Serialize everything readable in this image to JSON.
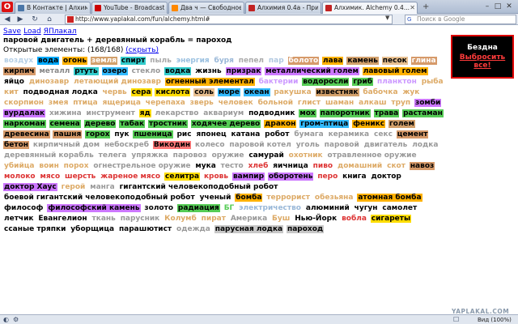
{
  "browser": {
    "menu_glyph": "O",
    "tabs": [
      {
        "label": "В Контакте | Алхими...",
        "favicon_color": "#4a76a8"
      },
      {
        "label": "YouTube - Broadcast Y...",
        "favicon_color": "#cc0000"
      },
      {
        "label": "Два ч — Свободное о...",
        "favicon_color": "#ff8800"
      },
      {
        "label": "Алхимия 0.4а - Прико...",
        "favicon_color": "#c22222"
      },
      {
        "label": "Алхимик. Alchemy 0.4...",
        "favicon_color": "#c22222",
        "active": true
      }
    ],
    "new_tab": "+",
    "address": "http://www.yaplakal.com/fun/alchemy.html#",
    "search_placeholder": "Поиск в Google",
    "search_engine_glyph": "G",
    "zoom_label": "Вид (100%)",
    "nav": {
      "back": "◀",
      "forward": "▶",
      "reload": "↻",
      "home": "⌂"
    },
    "window": {
      "minimize": "–",
      "maximize": "□",
      "close": "✕"
    },
    "status_icons": [
      "◐",
      "⚙",
      "☐"
    ]
  },
  "page": {
    "links": [
      "Save",
      "Load",
      "ЯПлакал"
    ],
    "recipe": "паровой двигатель + деревянный корабль = пароход",
    "opened_prefix": "Открытые элементы: (168/168)",
    "hide_link": "(скрыть)",
    "abyss_title": "Бездна",
    "abyss_link": "Выбросить все!",
    "watermark": "YAPLAKAL.COM",
    "elements": [
      {
        "t": "воздух",
        "bg": "#ffffff",
        "fg": "#b5cfe6"
      },
      {
        "t": "вода",
        "bg": "#00aaff",
        "fg": "#000000"
      },
      {
        "t": "огонь",
        "bg": "#ffb100",
        "fg": "#000000"
      },
      {
        "t": "земля",
        "bg": "#d2a06b",
        "fg": "#ffffff"
      },
      {
        "t": "спирт",
        "bg": "#33cccc",
        "fg": "#000000"
      },
      {
        "t": "пыль",
        "bg": "#ffffff",
        "fg": "#aaaaaa"
      },
      {
        "t": "энергия",
        "bg": "#ffffff",
        "fg": "#9ac0e0"
      },
      {
        "t": "буря",
        "bg": "#ffffff",
        "fg": "#9ab8d8"
      },
      {
        "t": "пепел",
        "bg": "#ffffff",
        "fg": "#aaaaaa"
      },
      {
        "t": "пар",
        "bg": "#ffffff",
        "fg": "#b0c8e0"
      },
      {
        "t": "болото",
        "bg": "#d69a6a",
        "fg": "#ffffff"
      },
      {
        "t": "лава",
        "bg": "#ffb100",
        "fg": "#000000"
      },
      {
        "t": "камень",
        "bg": "#d2a06b",
        "fg": "#000000"
      },
      {
        "t": "песок",
        "bg": "#e8c090",
        "fg": "#000000"
      },
      {
        "t": "глина",
        "bg": "#d69a6a",
        "fg": "#ffffff"
      },
      {
        "t": "кирпич",
        "bg": "#d69a6a",
        "fg": "#000000"
      },
      {
        "t": "металл",
        "bg": "#ffffff",
        "fg": "#888888"
      },
      {
        "t": "ртуть",
        "bg": "#33cccc",
        "fg": "#000000"
      },
      {
        "t": "озеро",
        "bg": "#33bbff",
        "fg": "#000000"
      },
      {
        "t": "стекло",
        "bg": "#ffffff",
        "fg": "#999999"
      },
      {
        "t": "водка",
        "bg": "#33cccc",
        "fg": "#000000"
      },
      {
        "t": "жизнь",
        "bg": "#ffffff",
        "fg": "#000000"
      },
      {
        "t": "призрак",
        "bg": "#cc77ff",
        "fg": "#000000"
      },
      {
        "t": "металлический голем",
        "bg": "#cc77ff",
        "fg": "#000000"
      },
      {
        "t": "лавовый голем",
        "bg": "#ffb100",
        "fg": "#000000"
      },
      {
        "t": "яйцо",
        "bg": "#ffffff",
        "fg": "#000000"
      },
      {
        "t": "динозавр",
        "bg": "#ffffff",
        "fg": "#ddaa66"
      },
      {
        "t": "летающий динозавр",
        "bg": "#ffffff",
        "fg": "#ddaa66"
      },
      {
        "t": "огненный элементал",
        "bg": "#ffb100",
        "fg": "#000000"
      },
      {
        "t": "бактерии",
        "bg": "#ffffff",
        "fg": "#cc99ff"
      },
      {
        "t": "водоросли",
        "bg": "#55cc55",
        "fg": "#000000"
      },
      {
        "t": "гриб",
        "bg": "#55cc55",
        "fg": "#000000"
      },
      {
        "t": "планктон",
        "bg": "#ffffff",
        "fg": "#cc99ff"
      },
      {
        "t": "рыба",
        "bg": "#ffffff",
        "fg": "#ddaa66"
      },
      {
        "t": "кит",
        "bg": "#ffffff",
        "fg": "#ddaa66"
      },
      {
        "t": "подводная лодка",
        "bg": "#ffffff",
        "fg": "#000000"
      },
      {
        "t": "червь",
        "bg": "#ffffff",
        "fg": "#ddaa66"
      },
      {
        "t": "сера",
        "bg": "#ffdd00",
        "fg": "#000000"
      },
      {
        "t": "кислота",
        "bg": "#ffdd00",
        "fg": "#000000"
      },
      {
        "t": "соль",
        "bg": "#e8c090",
        "fg": "#000000"
      },
      {
        "t": "море",
        "bg": "#33bbff",
        "fg": "#000000"
      },
      {
        "t": "океан",
        "bg": "#33bbff",
        "fg": "#000000"
      },
      {
        "t": "ракушка",
        "bg": "#ffffff",
        "fg": "#ddaa66"
      },
      {
        "t": "известняк",
        "bg": "#d2a06b",
        "fg": "#000000"
      },
      {
        "t": "бабочка",
        "bg": "#ffffff",
        "fg": "#ddaa66"
      },
      {
        "t": "жук",
        "bg": "#ffffff",
        "fg": "#ddaa66"
      },
      {
        "t": "скорпион",
        "bg": "#ffffff",
        "fg": "#ddaa66"
      },
      {
        "t": "змея",
        "bg": "#ffffff",
        "fg": "#ddaa66"
      },
      {
        "t": "птица",
        "bg": "#ffffff",
        "fg": "#ddaa66"
      },
      {
        "t": "ящерица",
        "bg": "#ffffff",
        "fg": "#ddaa66"
      },
      {
        "t": "черепаха",
        "bg": "#ffffff",
        "fg": "#ddaa66"
      },
      {
        "t": "зверь",
        "bg": "#ffffff",
        "fg": "#ddaa66"
      },
      {
        "t": "человек",
        "bg": "#ffffff",
        "fg": "#ddaa66"
      },
      {
        "t": "больной",
        "bg": "#ffffff",
        "fg": "#ddaa66"
      },
      {
        "t": "глист",
        "bg": "#ffffff",
        "fg": "#ddaa66"
      },
      {
        "t": "шаман",
        "bg": "#ffffff",
        "fg": "#ddaa66"
      },
      {
        "t": "алкаш",
        "bg": "#ffffff",
        "fg": "#ddaa66"
      },
      {
        "t": "труп",
        "bg": "#ffffff",
        "fg": "#ddaa66"
      },
      {
        "t": "зомби",
        "bg": "#cc77ff",
        "fg": "#000000"
      },
      {
        "t": "вурдалак",
        "bg": "#cc77ff",
        "fg": "#000000"
      },
      {
        "t": "хижина",
        "bg": "#ffffff",
        "fg": "#999999"
      },
      {
        "t": "инструмент",
        "bg": "#ffffff",
        "fg": "#999999"
      },
      {
        "t": "яд",
        "bg": "#ffdd00",
        "fg": "#000000"
      },
      {
        "t": "лекарство",
        "bg": "#ffffff",
        "fg": "#999999"
      },
      {
        "t": "аквариум",
        "bg": "#ffffff",
        "fg": "#999999"
      },
      {
        "t": "подводник",
        "bg": "#ffffff",
        "fg": "#000000"
      },
      {
        "t": "мох",
        "bg": "#55cc55",
        "fg": "#000000"
      },
      {
        "t": "папоротник",
        "bg": "#55cc55",
        "fg": "#000000"
      },
      {
        "t": "трава",
        "bg": "#55cc55",
        "fg": "#000000"
      },
      {
        "t": "растаман",
        "bg": "#55cc55",
        "fg": "#000000"
      },
      {
        "t": "наркоман",
        "bg": "#55cc55",
        "fg": "#000000"
      },
      {
        "t": "семена",
        "bg": "#55cc55",
        "fg": "#000000"
      },
      {
        "t": "дерево",
        "bg": "#55cc55",
        "fg": "#000000"
      },
      {
        "t": "табак",
        "bg": "#55cc55",
        "fg": "#000000"
      },
      {
        "t": "тростник",
        "bg": "#55cc55",
        "fg": "#000000"
      },
      {
        "t": "ходячее дерево",
        "bg": "#55cc55",
        "fg": "#000000"
      },
      {
        "t": "дракон",
        "bg": "#ffb100",
        "fg": "#000000"
      },
      {
        "t": "гром-птица",
        "bg": "#33bbff",
        "fg": "#000000"
      },
      {
        "t": "феникс",
        "bg": "#ffb100",
        "fg": "#000000"
      },
      {
        "t": "голем",
        "bg": "#d2a06b",
        "fg": "#000000"
      },
      {
        "t": "древесина",
        "bg": "#d69a6a",
        "fg": "#000000"
      },
      {
        "t": "пашня",
        "bg": "#d69a6a",
        "fg": "#000000"
      },
      {
        "t": "горох",
        "bg": "#55cc55",
        "fg": "#000000"
      },
      {
        "t": "пук",
        "bg": "#ffffff",
        "fg": "#000000"
      },
      {
        "t": "пшеница",
        "bg": "#55cc55",
        "fg": "#000000"
      },
      {
        "t": "рис",
        "bg": "#ffffff",
        "fg": "#000000"
      },
      {
        "t": "японец",
        "bg": "#ffffff",
        "fg": "#000000"
      },
      {
        "t": "катана",
        "bg": "#ffffff",
        "fg": "#000000"
      },
      {
        "t": "робот",
        "bg": "#ffffff",
        "fg": "#000000"
      },
      {
        "t": "бумага",
        "bg": "#ffffff",
        "fg": "#999999"
      },
      {
        "t": "керамика",
        "bg": "#ffffff",
        "fg": "#999999"
      },
      {
        "t": "секс",
        "bg": "#ffffff",
        "fg": "#999999"
      },
      {
        "t": "цемент",
        "bg": "#d69a6a",
        "fg": "#000000"
      },
      {
        "t": "бетон",
        "bg": "#d69a6a",
        "fg": "#000000"
      },
      {
        "t": "кирпичный дом",
        "bg": "#ffffff",
        "fg": "#999999"
      },
      {
        "t": "небоскреб",
        "bg": "#ffffff",
        "fg": "#999999"
      },
      {
        "t": "Викодин",
        "bg": "#ff7777",
        "fg": "#000000"
      },
      {
        "t": "колесо",
        "bg": "#ffffff",
        "fg": "#999999"
      },
      {
        "t": "паровой котел",
        "bg": "#ffffff",
        "fg": "#999999"
      },
      {
        "t": "уголь",
        "bg": "#ffffff",
        "fg": "#999999"
      },
      {
        "t": "паровой",
        "bg": "#ffffff",
        "fg": "#999999"
      },
      {
        "t": "двигатель",
        "bg": "#ffffff",
        "fg": "#999999"
      },
      {
        "t": "лодка",
        "bg": "#ffffff",
        "fg": "#999999"
      },
      {
        "t": "деревянный корабль",
        "bg": "#ffffff",
        "fg": "#999999"
      },
      {
        "t": "телега",
        "bg": "#ffffff",
        "fg": "#999999"
      },
      {
        "t": "упряжка",
        "bg": "#ffffff",
        "fg": "#999999"
      },
      {
        "t": "паровоз",
        "bg": "#ffffff",
        "fg": "#999999"
      },
      {
        "t": "оружие",
        "bg": "#ffffff",
        "fg": "#999999"
      },
      {
        "t": "самурай",
        "bg": "#ffffff",
        "fg": "#000000"
      },
      {
        "t": "охотник",
        "bg": "#ffffff",
        "fg": "#ddaa66"
      },
      {
        "t": "отравленное оружие",
        "bg": "#ffffff",
        "fg": "#999999"
      },
      {
        "t": "убийца",
        "bg": "#ffffff",
        "fg": "#ddaa66"
      },
      {
        "t": "воин",
        "bg": "#ffffff",
        "fg": "#ddaa66"
      },
      {
        "t": "порох",
        "bg": "#ffffff",
        "fg": "#ddaa66"
      },
      {
        "t": "огнестрельное оружие",
        "bg": "#ffffff",
        "fg": "#999999"
      },
      {
        "t": "мука",
        "bg": "#ffffff",
        "fg": "#000000"
      },
      {
        "t": "тесто",
        "bg": "#ffffff",
        "fg": "#999999"
      },
      {
        "t": "хлеб",
        "bg": "#ffffff",
        "fg": "#dd3333"
      },
      {
        "t": "яичница",
        "bg": "#ffffff",
        "fg": "#000000"
      },
      {
        "t": "пиво",
        "bg": "#ffffff",
        "fg": "#dd3333"
      },
      {
        "t": "домашний",
        "bg": "#ffffff",
        "fg": "#ddaa66"
      },
      {
        "t": "скот",
        "bg": "#ffffff",
        "fg": "#ddaa66"
      },
      {
        "t": "навоз",
        "bg": "#d69a6a",
        "fg": "#000000"
      },
      {
        "t": "молоко",
        "bg": "#ffffff",
        "fg": "#dd3333"
      },
      {
        "t": "мясо",
        "bg": "#ffffff",
        "fg": "#dd3333"
      },
      {
        "t": "шерсть",
        "bg": "#ffffff",
        "fg": "#dd3333"
      },
      {
        "t": "жареное мясо",
        "bg": "#ffffff",
        "fg": "#dd3333"
      },
      {
        "t": "селитра",
        "bg": "#ffdd00",
        "fg": "#000000"
      },
      {
        "t": "кровь",
        "bg": "#ffffff",
        "fg": "#dd3333"
      },
      {
        "t": "вампир",
        "bg": "#cc77ff",
        "fg": "#000000"
      },
      {
        "t": "оборотень",
        "bg": "#cc77ff",
        "fg": "#000000"
      },
      {
        "t": "перо",
        "bg": "#ffffff",
        "fg": "#dd3333"
      },
      {
        "t": "книга",
        "bg": "#ffffff",
        "fg": "#000000"
      },
      {
        "t": "доктор",
        "bg": "#ffffff",
        "fg": "#000000"
      },
      {
        "t": "доктор Хаус",
        "bg": "#cc77ff",
        "fg": "#000000"
      },
      {
        "t": "герой",
        "bg": "#ffffff",
        "fg": "#ddaa66"
      },
      {
        "t": "манга",
        "bg": "#ffffff",
        "fg": "#999999"
      },
      {
        "t": "гигантский человекоподобный робот",
        "bg": "#ffffff",
        "fg": "#000000"
      },
      {
        "t": "боевой гигантский человекоподобный робот",
        "bg": "#ffffff",
        "fg": "#000000"
      },
      {
        "t": "ученый",
        "bg": "#ffffff",
        "fg": "#000000"
      },
      {
        "t": "бомба",
        "bg": "#ffb100",
        "fg": "#000000"
      },
      {
        "t": "террорист",
        "bg": "#ffffff",
        "fg": "#ddaa66"
      },
      {
        "t": "обезьяна",
        "bg": "#ffffff",
        "fg": "#ddaa66"
      },
      {
        "t": "атомная бомба",
        "bg": "#ffb100",
        "fg": "#000000"
      },
      {
        "t": "философ",
        "bg": "#ffffff",
        "fg": "#000000"
      },
      {
        "t": "философский камень",
        "bg": "#cc77ff",
        "fg": "#000000"
      },
      {
        "t": "золото",
        "bg": "#ffffff",
        "fg": "#000000"
      },
      {
        "t": "радиация",
        "bg": "#55cc55",
        "fg": "#000000"
      },
      {
        "t": "БГ",
        "bg": "#ffffff",
        "fg": "#55cc55"
      },
      {
        "t": "электричество",
        "bg": "#ffffff",
        "fg": "#9ab8d8"
      },
      {
        "t": "алюминий",
        "bg": "#ffffff",
        "fg": "#000000"
      },
      {
        "t": "чугун",
        "bg": "#ffffff",
        "fg": "#000000"
      },
      {
        "t": "самолет",
        "bg": "#ffffff",
        "fg": "#000000"
      },
      {
        "t": "летчик",
        "bg": "#ffffff",
        "fg": "#000000"
      },
      {
        "t": "Евангелион",
        "bg": "#ffffff",
        "fg": "#000000"
      },
      {
        "t": "ткань",
        "bg": "#ffffff",
        "fg": "#999999"
      },
      {
        "t": "парусник",
        "bg": "#ffffff",
        "fg": "#999999"
      },
      {
        "t": "Колумб",
        "bg": "#ffffff",
        "fg": "#ddaa66"
      },
      {
        "t": "пират",
        "bg": "#ffffff",
        "fg": "#ddaa66"
      },
      {
        "t": "Америка",
        "bg": "#ffffff",
        "fg": "#999999"
      },
      {
        "t": "Буш",
        "bg": "#ffffff",
        "fg": "#ddaa66"
      },
      {
        "t": "Нью-Йорк",
        "bg": "#ffffff",
        "fg": "#000000"
      },
      {
        "t": "вобла",
        "bg": "#ffffff",
        "fg": "#dd3333"
      },
      {
        "t": "сигареты",
        "bg": "#ffdd00",
        "fg": "#000000"
      },
      {
        "t": "ссаные тряпки",
        "bg": "#ffffff",
        "fg": "#000000"
      },
      {
        "t": "уборщица",
        "bg": "#ffffff",
        "fg": "#000000"
      },
      {
        "t": "парашютист",
        "bg": "#ffffff",
        "fg": "#000000"
      },
      {
        "t": "одежда",
        "bg": "#ffffff",
        "fg": "#999999"
      },
      {
        "t": "парусная лодка",
        "bg": "#c8c8c8",
        "fg": "#000000"
      },
      {
        "t": "пароход",
        "bg": "#c8c8c8",
        "fg": "#000000"
      }
    ]
  }
}
